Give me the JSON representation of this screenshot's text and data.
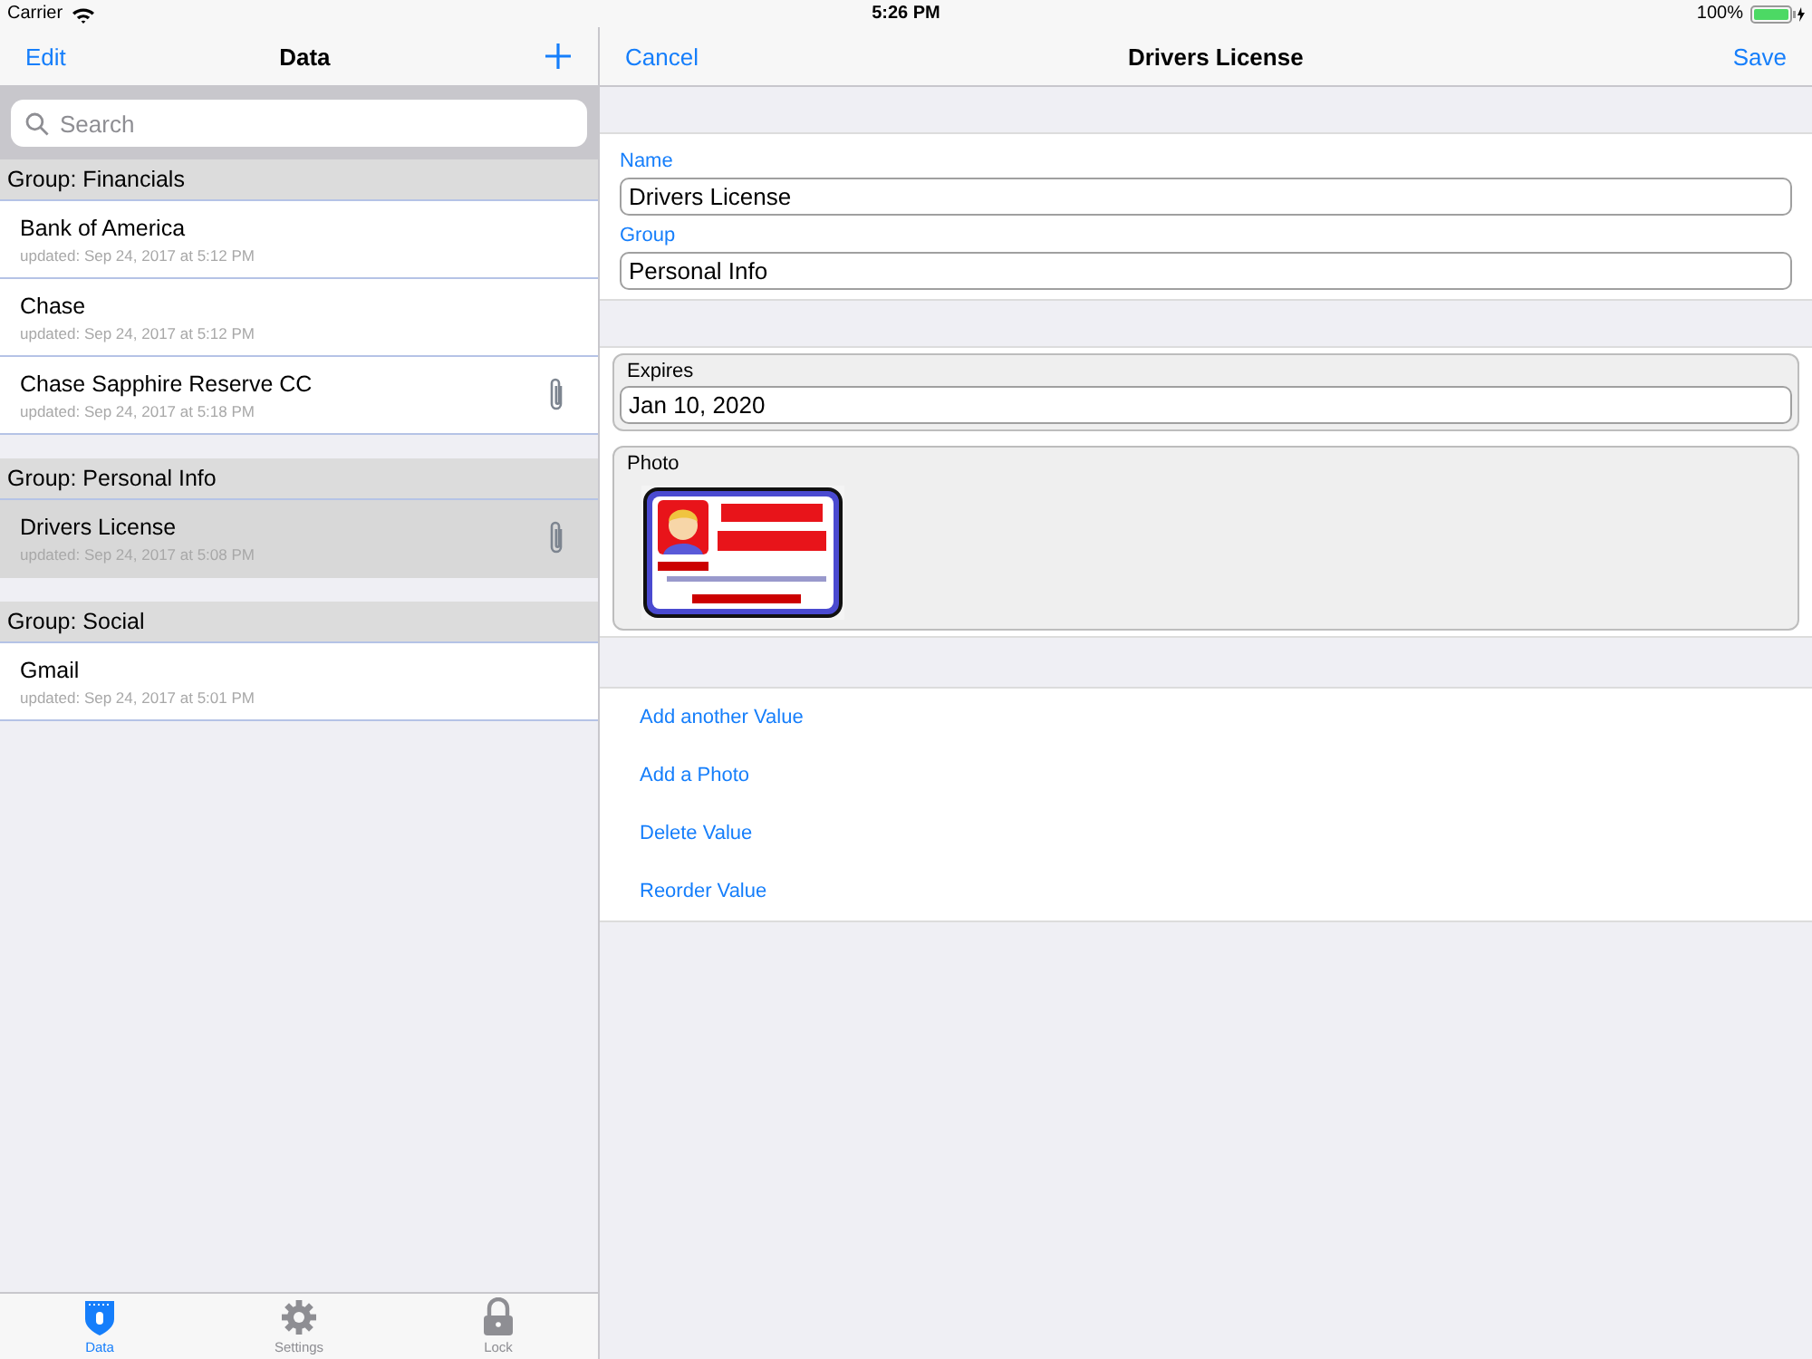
{
  "status_bar": {
    "carrier": "Carrier",
    "time": "5:26 PM",
    "battery": "100%"
  },
  "list_pane": {
    "nav": {
      "edit": "Edit",
      "title": "Data"
    },
    "search": {
      "placeholder": "Search"
    },
    "groups": [
      {
        "title": "Group: Financials",
        "items": [
          {
            "name": "Bank of America",
            "updated": "updated: Sep 24, 2017 at 5:12 PM",
            "attachment": false,
            "selected": false
          },
          {
            "name": "Chase",
            "updated": "updated: Sep 24, 2017 at 5:12 PM",
            "attachment": false,
            "selected": false
          },
          {
            "name": "Chase Sapphire Reserve CC",
            "updated": "updated: Sep 24, 2017 at 5:18 PM",
            "attachment": true,
            "selected": false
          }
        ]
      },
      {
        "title": "Group: Personal Info",
        "items": [
          {
            "name": "Drivers License",
            "updated": "updated: Sep 24, 2017 at 5:08 PM",
            "attachment": true,
            "selected": true
          }
        ]
      },
      {
        "title": "Group: Social",
        "items": [
          {
            "name": "Gmail",
            "updated": "updated: Sep 24, 2017 at 5:01 PM",
            "attachment": false,
            "selected": false
          }
        ]
      }
    ],
    "tab_bar": [
      {
        "label": "Data",
        "selected": true
      },
      {
        "label": "Settings",
        "selected": false
      },
      {
        "label": "Lock",
        "selected": false
      }
    ]
  },
  "detail_pane": {
    "nav": {
      "cancel": "Cancel",
      "title": "Drivers License",
      "save": "Save"
    },
    "fields": [
      {
        "label": "Name",
        "value": "Drivers License"
      },
      {
        "label": "Group",
        "value": "Personal Info"
      }
    ],
    "values": [
      {
        "kind": "text",
        "label": "Expires",
        "value": "Jan 10, 2020"
      },
      {
        "label": "Photo"
      }
    ],
    "actions": [
      "Add another Value",
      "Add a Photo",
      "Delete Value",
      "Reorder Value"
    ]
  }
}
